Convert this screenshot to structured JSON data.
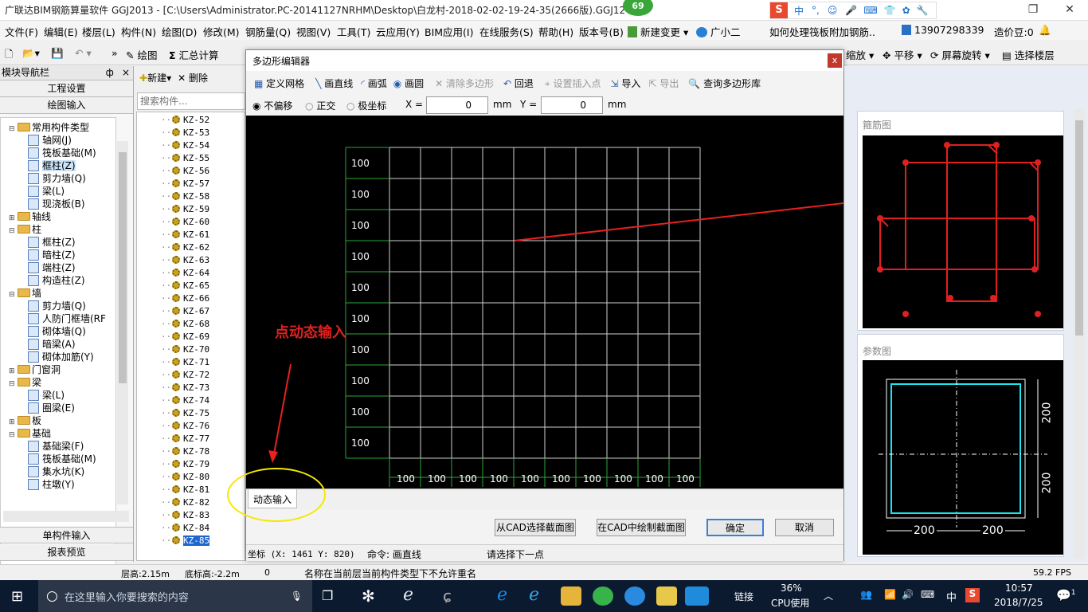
{
  "title_bar": {
    "title": "广联达BIM钢筋算量软件 GGJ2013 - [C:\\Users\\Administrator.PC-20141127NRHM\\Desktop\\白龙村-2018-02-02-19-24-35(2666版).GGJ12",
    "badge": "69"
  },
  "ime_toolbar": {
    "items": [
      "中",
      "°,",
      "☺",
      "🎤",
      "⌨",
      "👕",
      "✿",
      "🔧"
    ]
  },
  "menu": {
    "items": [
      "文件(F)",
      "编辑(E)",
      "楼层(L)",
      "构件(N)",
      "绘图(D)",
      "修改(M)",
      "钢筋量(Q)",
      "视图(V)",
      "工具(T)",
      "云应用(Y)",
      "BIM应用(I)",
      "在线服务(S)",
      "帮助(H)",
      "版本号(B)",
      "新建变更",
      "广小二"
    ],
    "question": "如何处理筏板附加钢筋..",
    "phone": "13907298339",
    "price": "造价豆:0"
  },
  "toolbar": {
    "draw": "绘图",
    "summary": "汇总计算",
    "zoom": "缩放",
    "pan": "平移",
    "rotate": "屏幕旋转",
    "select_floor": "选择楼层"
  },
  "nav": {
    "title": "模块导航栏",
    "pin": "ф",
    "close": "×",
    "project_settings": "工程设置",
    "drawing_input": "绘图输入",
    "single_input": "单构件输入",
    "report": "报表预览",
    "tree": [
      {
        "label": "常用构件类型",
        "level": 0,
        "exp": "⊟",
        "folder": true
      },
      {
        "label": "轴网(J)",
        "level": 1
      },
      {
        "label": "筏板基础(M)",
        "level": 1
      },
      {
        "label": "框柱(Z)",
        "level": 1,
        "selected": true
      },
      {
        "label": "剪力墙(Q)",
        "level": 1
      },
      {
        "label": "梁(L)",
        "level": 1
      },
      {
        "label": "现浇板(B)",
        "level": 1
      },
      {
        "label": "轴线",
        "level": 0,
        "exp": "⊞",
        "folder": true
      },
      {
        "label": "柱",
        "level": 0,
        "exp": "⊟",
        "folder": true
      },
      {
        "label": "框柱(Z)",
        "level": 1
      },
      {
        "label": "暗柱(Z)",
        "level": 1
      },
      {
        "label": "端柱(Z)",
        "level": 1
      },
      {
        "label": "构造柱(Z)",
        "level": 1
      },
      {
        "label": "墙",
        "level": 0,
        "exp": "⊟",
        "folder": true
      },
      {
        "label": "剪力墙(Q)",
        "level": 1
      },
      {
        "label": "人防门框墙(RF",
        "level": 1
      },
      {
        "label": "砌体墙(Q)",
        "level": 1
      },
      {
        "label": "暗梁(A)",
        "level": 1
      },
      {
        "label": "砌体加筋(Y)",
        "level": 1
      },
      {
        "label": "门窗洞",
        "level": 0,
        "exp": "⊞",
        "folder": true
      },
      {
        "label": "梁",
        "level": 0,
        "exp": "⊟",
        "folder": true
      },
      {
        "label": "梁(L)",
        "level": 1
      },
      {
        "label": "圈梁(E)",
        "level": 1
      },
      {
        "label": "板",
        "level": 0,
        "exp": "⊞",
        "folder": true
      },
      {
        "label": "基础",
        "level": 0,
        "exp": "⊟",
        "folder": true
      },
      {
        "label": "基础梁(F)",
        "level": 1
      },
      {
        "label": "筏板基础(M)",
        "level": 1
      },
      {
        "label": "集水坑(K)",
        "level": 1
      },
      {
        "label": "柱墩(Y)",
        "level": 1
      }
    ]
  },
  "component_panel": {
    "new": "新建",
    "delete": "删除",
    "search_placeholder": "搜索构件...",
    "items": [
      "KZ-52",
      "KZ-53",
      "KZ-54",
      "KZ-55",
      "KZ-56",
      "KZ-57",
      "KZ-58",
      "KZ-59",
      "KZ-60",
      "KZ-61",
      "KZ-62",
      "KZ-63",
      "KZ-64",
      "KZ-65",
      "KZ-66",
      "KZ-67",
      "KZ-68",
      "KZ-69",
      "KZ-70",
      "KZ-71",
      "KZ-72",
      "KZ-73",
      "KZ-74",
      "KZ-75",
      "KZ-76",
      "KZ-77",
      "KZ-78",
      "KZ-79",
      "KZ-80",
      "KZ-81",
      "KZ-82",
      "KZ-83",
      "KZ-84",
      "KZ-85"
    ],
    "selected": "KZ-85"
  },
  "dialog": {
    "title": "多边形编辑器",
    "close": "x",
    "toolbar": [
      "定义网格",
      "画直线",
      "画弧",
      "画圆",
      "清除多边形",
      "回退",
      "设置插入点",
      "导入",
      "导出",
      "查询多边形库"
    ],
    "modes": [
      "不偏移",
      "正交",
      "极坐标"
    ],
    "x_label": "X =",
    "x_value": "0",
    "y_label": "Y =",
    "y_value": "0",
    "unit": "mm",
    "grid_labels_y": [
      "100",
      "100",
      "100",
      "100",
      "100",
      "100",
      "100",
      "100",
      "100",
      "100"
    ],
    "grid_labels_x": [
      "100",
      "100",
      "100",
      "100",
      "100",
      "100",
      "100",
      "100",
      "100",
      "100"
    ],
    "annotation": "点动态输入",
    "dynamic_input": "动态输入",
    "btn_cad_select": "从CAD选择截面图",
    "btn_cad_draw": "在CAD中绘制截面图",
    "btn_ok": "确定",
    "btn_cancel": "取消",
    "status_coord": "坐标 (X: 1461 Y: 820)",
    "status_cmd": "命令: 画直线",
    "status_prompt": "请选择下一点"
  },
  "right_panel": {
    "rebar_title": "箍筋图",
    "param_title": "参数图",
    "dims": [
      "200",
      "200",
      "200",
      "200"
    ]
  },
  "statusbar": {
    "floor_height": "层高:2.15m",
    "bottom_elev": "底标高:-2.2m",
    "zero": "0",
    "message": "名称在当前层当前构件类型下不允许重名",
    "fps": "59.2 FPS"
  },
  "taskbar": {
    "search_placeholder": "在这里输入你要搜索的内容",
    "link": "链接",
    "cpu_pct": "36%",
    "cpu_label": "CPU使用",
    "ime": "中",
    "time": "10:57",
    "date": "2018/7/25",
    "notif": "1"
  }
}
